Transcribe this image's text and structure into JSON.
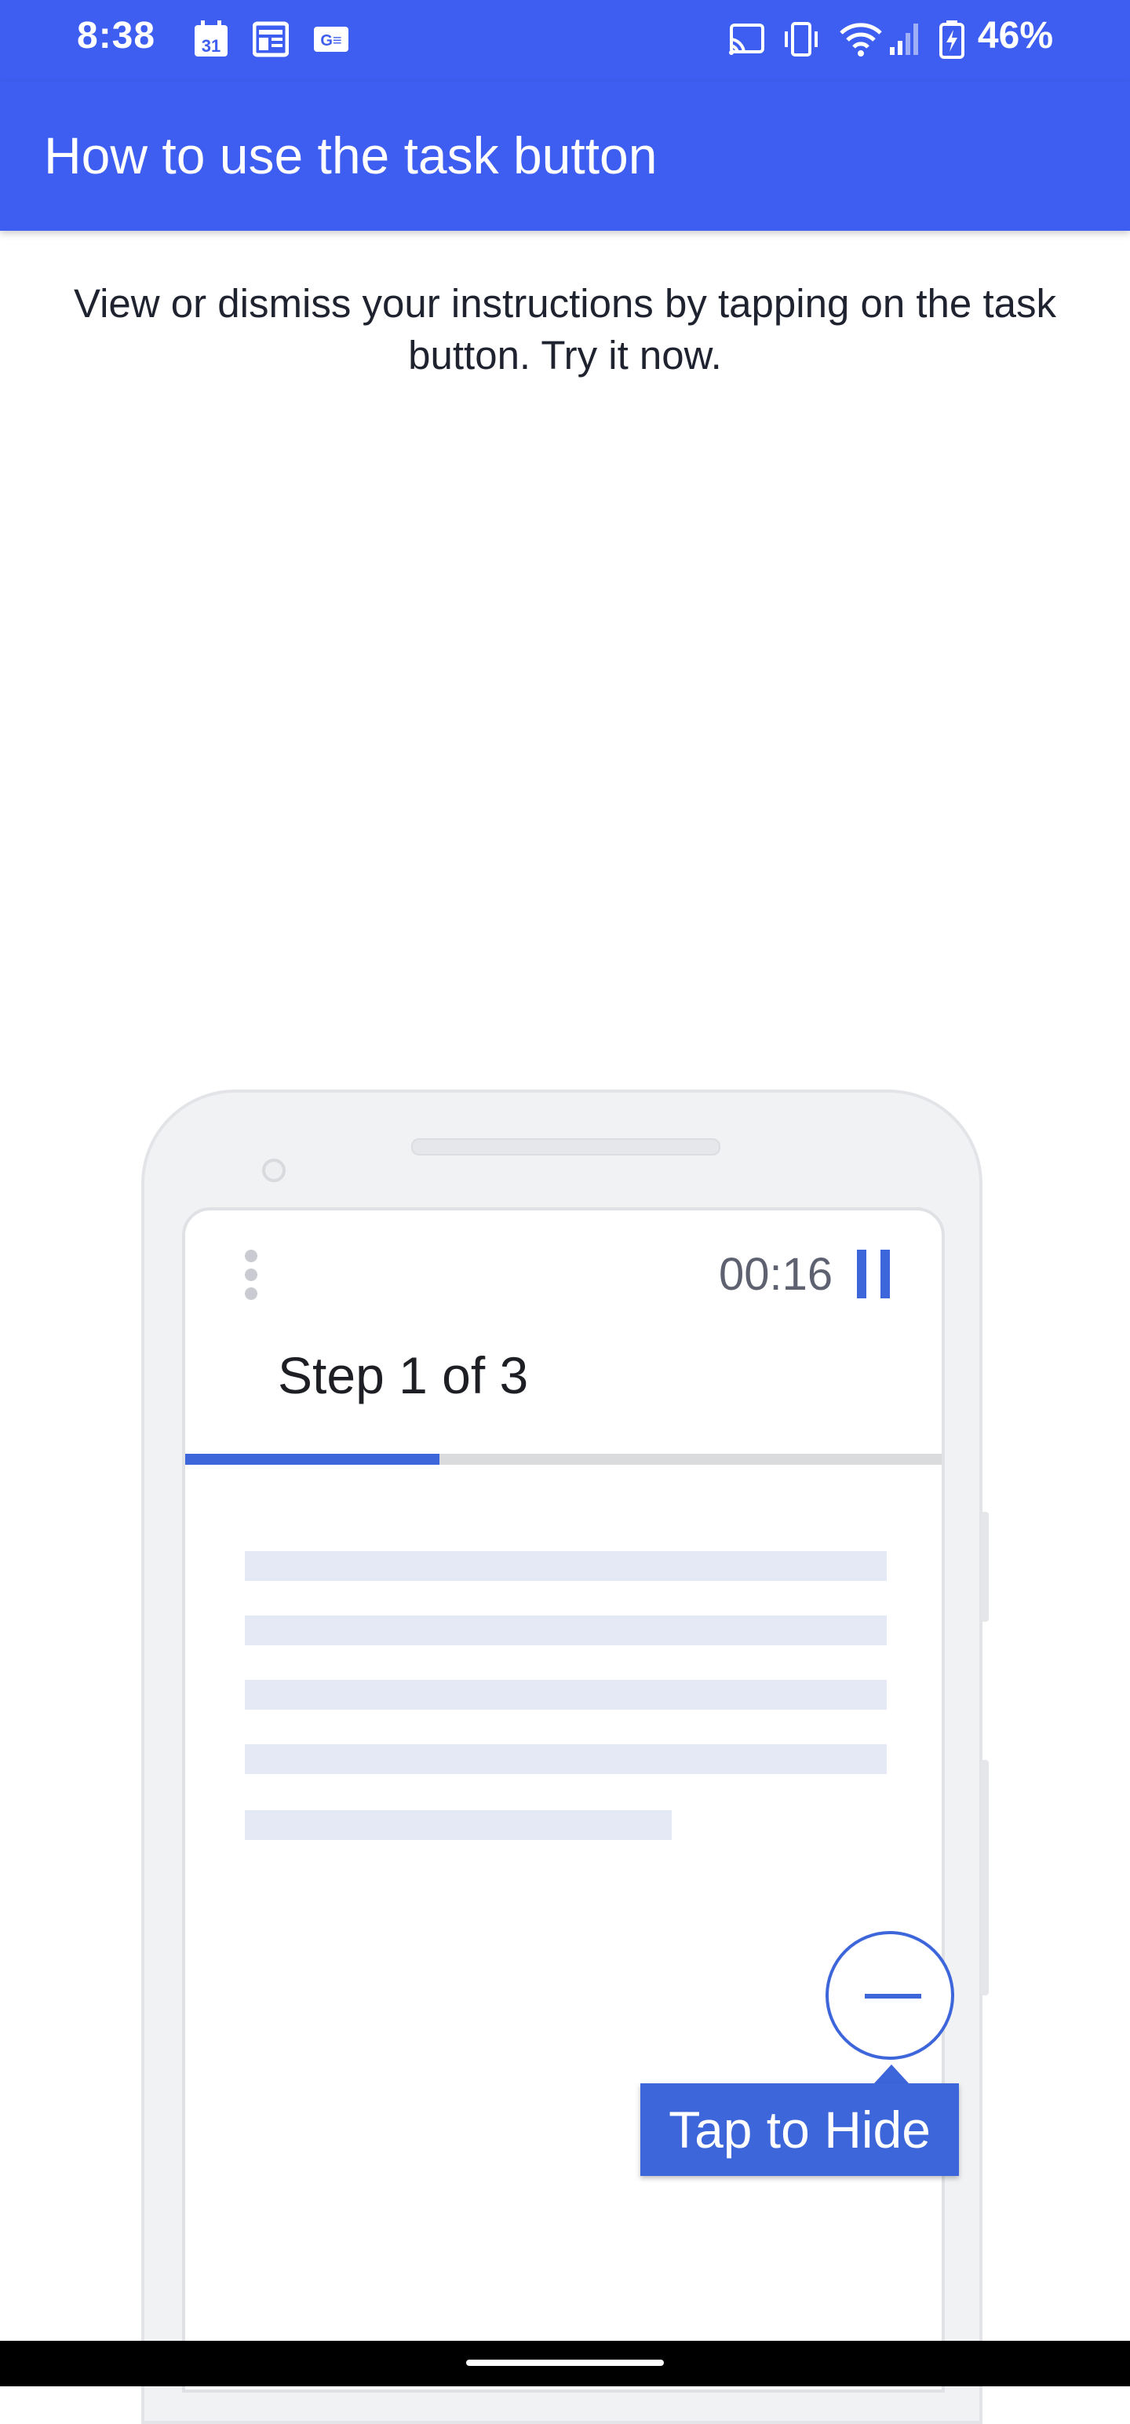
{
  "status_bar": {
    "time": "8:38",
    "battery_percent": "46%",
    "calendar_day": "31",
    "left_icons": [
      "calendar-icon",
      "news-icon",
      "google-news-icon"
    ],
    "right_icons": [
      "cast-icon",
      "vibrate-icon",
      "wifi-icon",
      "signal-icon",
      "battery-charging-icon"
    ]
  },
  "app_bar": {
    "title": "How to use the task button",
    "color": "#3d5ef0"
  },
  "instructions": {
    "text": "View or dismiss your instructions by tapping on the task button. Try it now."
  },
  "illustration": {
    "timer": "00:16",
    "step_title": "Step 1 of 3",
    "progress_fraction": 0.333,
    "task_button_tooltip": "Tap to Hide",
    "accent_color": "#3d66db"
  }
}
